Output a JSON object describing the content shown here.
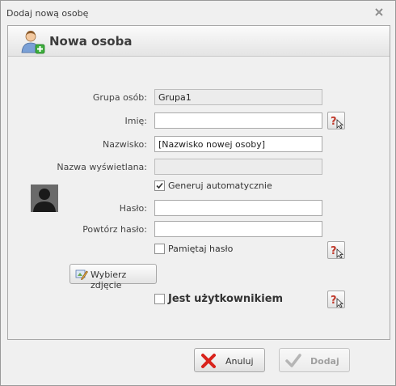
{
  "window": {
    "title": "Dodaj nową osobę"
  },
  "header": {
    "title": "Nowa osoba"
  },
  "form": {
    "group_label": "Grupa osób:",
    "group_value": "Grupa1",
    "first_name_label": "Imię:",
    "first_name_value": "",
    "last_name_label": "Nazwisko:",
    "last_name_value": "[Nazwisko nowej osoby]",
    "display_name_label": "Nazwa wyświetlana:",
    "display_name_value": "",
    "generate_label": "Generuj automatycznie",
    "generate_checked": true,
    "password_label": "Hasło:",
    "password_value": "",
    "password_repeat_label": "Powtórz hasło:",
    "password_repeat_value": "",
    "remember_label": "Pamiętaj hasło",
    "remember_checked": false,
    "is_user_label": "Jest użytkownikiem",
    "is_user_checked": false,
    "photo_button_label": "Wybierz zdjęcie"
  },
  "footer": {
    "cancel_label": "Anuluj",
    "add_label": "Dodaj"
  },
  "colors": {
    "help_icon": "#c0392b",
    "cancel_icon": "#d9231c",
    "add_icon_disabled": "#b5b5b5"
  }
}
